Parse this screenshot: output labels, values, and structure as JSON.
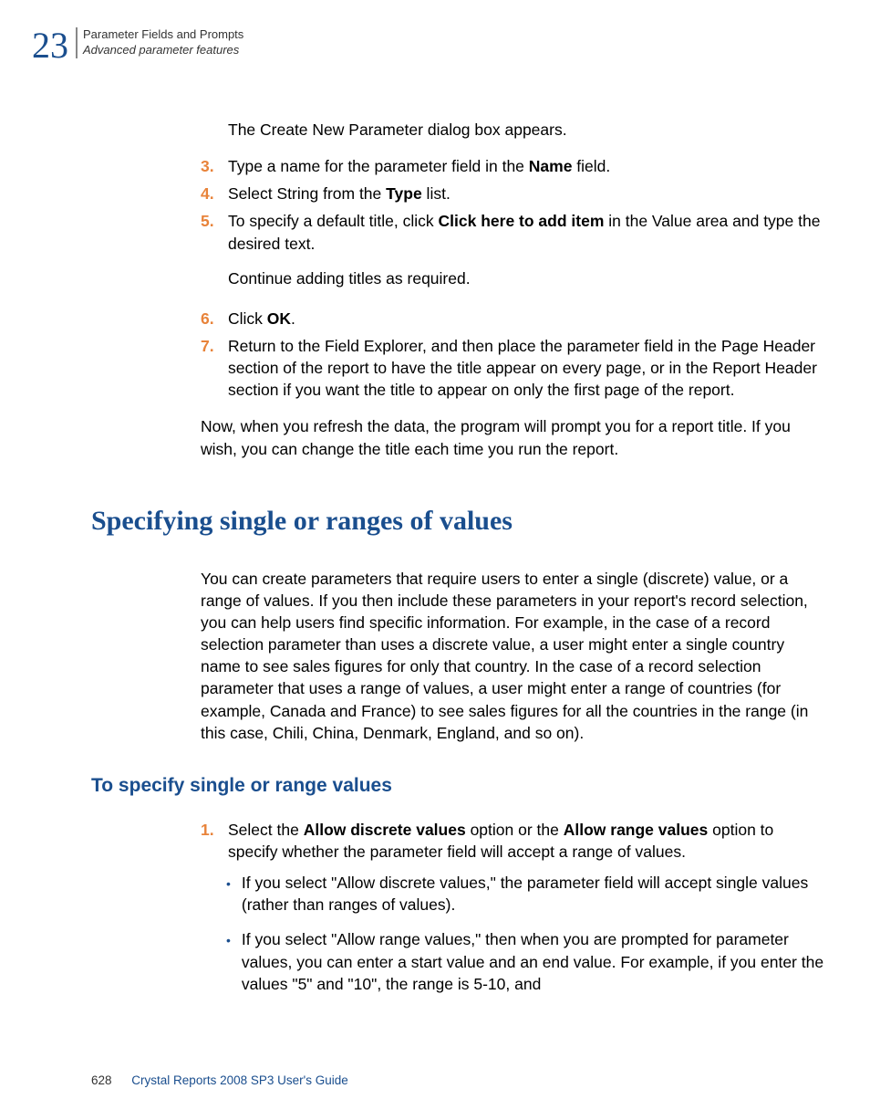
{
  "header": {
    "chapter_number": "23",
    "title": "Parameter Fields and Prompts",
    "subtitle": "Advanced parameter features"
  },
  "intro_para": "The Create New Parameter dialog box appears.",
  "steps": {
    "s3": {
      "num": "3.",
      "before": "Type a name for the parameter field in the ",
      "bold": "Name",
      "after": " field."
    },
    "s4": {
      "num": "4.",
      "before": "Select String from the ",
      "bold": "Type",
      "after": " list."
    },
    "s5": {
      "num": "5.",
      "before": "To specify a default title, click ",
      "bold": "Click here to add item",
      "after": " in the Value area and type the desired text.",
      "extra": "Continue adding titles as required."
    },
    "s6": {
      "num": "6.",
      "before": "Click ",
      "bold": "OK",
      "after": "."
    },
    "s7": {
      "num": "7.",
      "text": "Return to the Field Explorer, and then place the parameter field in the Page Header section of the report to have the title appear on every page, or in the Report Header section if you want the title to appear on only the first page of the report."
    }
  },
  "closing_para": "Now, when you refresh the data, the program will prompt you for a report title. If you wish, you can change the title each time you run the report.",
  "h2": "Specifying single or ranges of values",
  "section_para": "You can create parameters that require users to enter a single (discrete) value, or a range of values. If you then include these parameters in your report's record selection, you can help users find specific information. For example, in the case of a record selection parameter than uses a discrete value, a user might enter a single country name to see sales figures for only that country. In the case of a record selection parameter that uses a range of values, a user might enter a range of countries (for example, Canada and France) to see sales figures for all the countries in the range (in this case, Chili, China, Denmark, England, and so on).",
  "h3": "To specify single or range values",
  "step1": {
    "num": "1.",
    "p1": "Select the ",
    "b1": "Allow discrete values",
    "p2": " option or the ",
    "b2": "Allow range values",
    "p3": " option to specify whether the parameter field will accept a range of values."
  },
  "bullets": {
    "b1": "If you select \"Allow discrete values,\" the parameter field will accept single values (rather than ranges of values).",
    "b2": "If you select \"Allow range values,\" then when you are prompted for parameter values, you can enter a start value and an end value. For example, if you enter the values \"5\" and \"10\", the range is 5-10, and"
  },
  "footer": {
    "page": "628",
    "book": "Crystal Reports 2008 SP3 User's Guide"
  }
}
